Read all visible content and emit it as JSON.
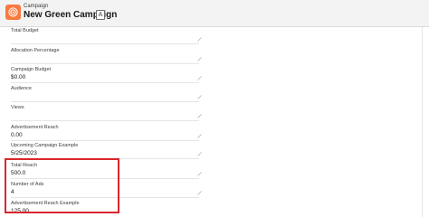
{
  "header": {
    "icon": "campaign-icon",
    "object_label": "Campaign",
    "record_title": "New Green Campaign",
    "follow_glyph": "A"
  },
  "fields": [
    {
      "label": "Total Budget",
      "value": ""
    },
    {
      "label": "Allocation Percentage",
      "value": ""
    },
    {
      "label": "Campaign Budget",
      "value": "$0.00"
    },
    {
      "label": "Audience",
      "value": ""
    },
    {
      "label": "Views",
      "value": ""
    },
    {
      "label": "Advertisement Reach",
      "value": "0.00"
    },
    {
      "label": "Upcoming Campaign Example",
      "value": "5/25/2023"
    },
    {
      "label": "Total Reach",
      "value": "500.0"
    },
    {
      "label": "Number of Ads",
      "value": "4"
    },
    {
      "label": "Advertisement Reach Example",
      "value": "125.00"
    }
  ],
  "colors": {
    "highlight": "#d8272d",
    "app_icon": "#f97a3e"
  }
}
